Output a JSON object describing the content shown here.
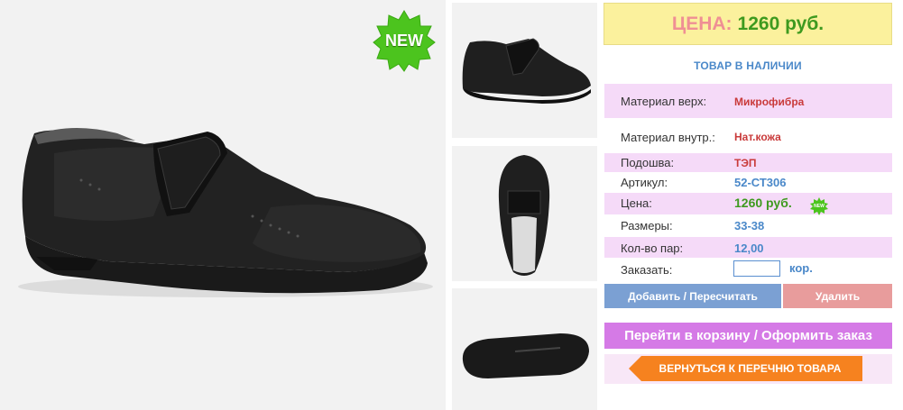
{
  "badge": {
    "new_text": "NEW",
    "new_mini_text": "NEW"
  },
  "price_box": {
    "label": "ЦЕНА:",
    "value": "1260 руб."
  },
  "stock_status": "ТОВАР В НАЛИЧИИ",
  "specs": [
    {
      "label": "Материал верх:",
      "value": "Микрофибра"
    },
    {
      "label": "Материал внутр.:",
      "value": "Нат.кожа"
    },
    {
      "label": "Подошва:",
      "value": "ТЭП"
    },
    {
      "label": "Артикул:",
      "value": "52-СТ306"
    },
    {
      "label": "Цена:",
      "value": "1260 руб."
    },
    {
      "label": "Размеры:",
      "value": "33-38"
    },
    {
      "label": "Кол-во пар:",
      "value": "12,00"
    }
  ],
  "order": {
    "label": "Заказать:",
    "value": "",
    "unit": "кор."
  },
  "buttons": {
    "add": "Добавить / Пересчитать",
    "delete": "Удалить",
    "cart": "Перейти в корзину / Оформить заказ",
    "back": "ВЕРНУТЬСЯ К ПЕРЕЧНЮ ТОВАРА"
  },
  "colors": {
    "price_label": "#ef8f94",
    "price_value": "#3e9a1f",
    "accent_blue": "#4a88c9",
    "cart_button": "#d57ae6",
    "back_button": "#f6821f"
  }
}
